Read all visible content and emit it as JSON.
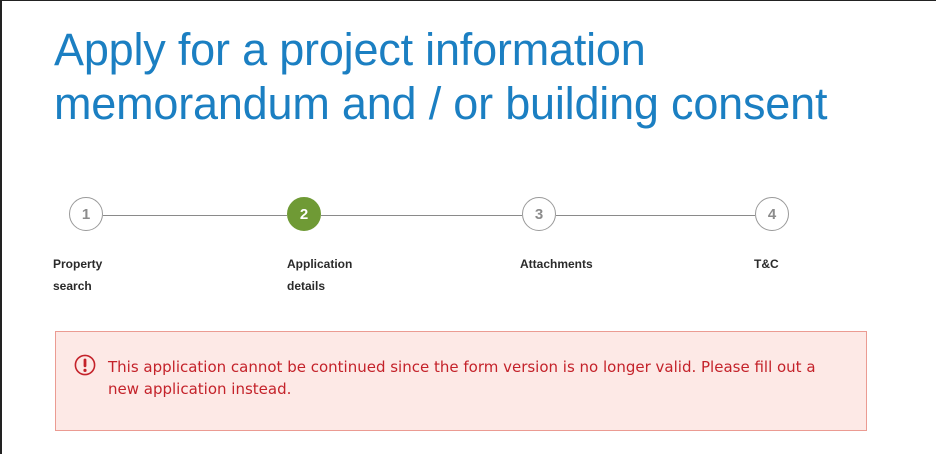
{
  "page": {
    "title_line1": "Apply for a project information",
    "title_line2": "memorandum and / or building consent"
  },
  "stepper": {
    "current_step": 2,
    "steps": [
      {
        "number": "1",
        "label_line1": "Property",
        "label_line2": "search"
      },
      {
        "number": "2",
        "label_line1": "Application",
        "label_line2": "details"
      },
      {
        "number": "3",
        "label_line1": "Attachments",
        "label_line2": ""
      },
      {
        "number": "4",
        "label_line1": "T&C",
        "label_line2": ""
      }
    ]
  },
  "alert": {
    "icon": "exclamation-circle-icon",
    "message": "This application cannot be continued since the form version is no longer valid. Please fill out a new application instead.",
    "colors": {
      "background": "#fde9e6",
      "border": "#eb9b92",
      "text": "#c4222a"
    }
  },
  "colors": {
    "title": "#1b7fc2",
    "active_step": "#6f9a35",
    "inactive_step_text": "#8c8c8c"
  }
}
